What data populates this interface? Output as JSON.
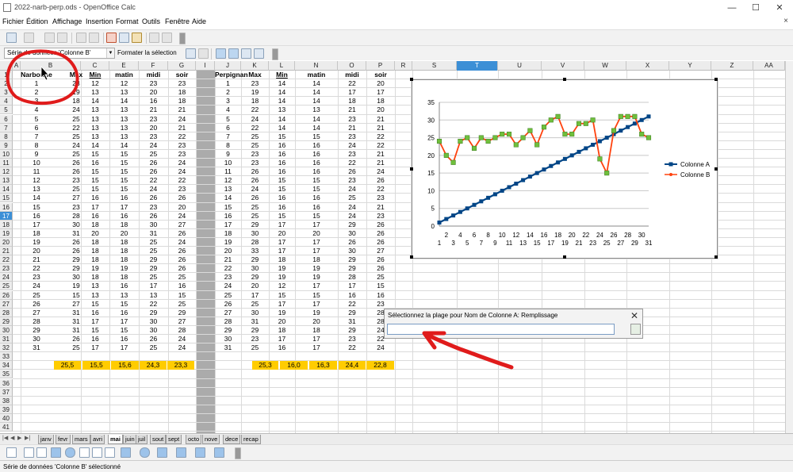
{
  "window": {
    "title": "2022-narb-perp.ods - OpenOffice Calc",
    "minimize": "—",
    "maximize": "☐",
    "close": "✕"
  },
  "menus": [
    "Fichier",
    "Édition",
    "Affichage",
    "Insertion",
    "Format",
    "Outils",
    "Fenêtre",
    "Aide"
  ],
  "menu_close": "×",
  "toolbar2": {
    "series_selector": "Série de données 'Colonne B'",
    "format_selection_label": "Formater la sélection"
  },
  "columns": [
    "A",
    "B",
    "C",
    "E",
    "F",
    "G",
    "I",
    "J",
    "K",
    "L",
    "N",
    "O",
    "P",
    "R",
    "S",
    "T",
    "U",
    "V",
    "W",
    "X",
    "Y",
    "Z",
    "AA"
  ],
  "selected_column": "T",
  "table_left": {
    "headers": [
      "Narbonne",
      "Max",
      "Min",
      "matin",
      "midi",
      "soir"
    ],
    "rows": [
      [
        1,
        23,
        12,
        12,
        23,
        23
      ],
      [
        2,
        19,
        13,
        13,
        20,
        18
      ],
      [
        3,
        18,
        14,
        14,
        16,
        18
      ],
      [
        4,
        24,
        13,
        13,
        21,
        21
      ],
      [
        5,
        25,
        13,
        13,
        23,
        24
      ],
      [
        6,
        22,
        13,
        13,
        20,
        21
      ],
      [
        7,
        25,
        13,
        13,
        23,
        22
      ],
      [
        8,
        24,
        14,
        14,
        24,
        23
      ],
      [
        9,
        25,
        15,
        15,
        25,
        23
      ],
      [
        10,
        26,
        16,
        15,
        26,
        24
      ],
      [
        11,
        26,
        15,
        15,
        26,
        24
      ],
      [
        12,
        23,
        15,
        15,
        22,
        22
      ],
      [
        13,
        25,
        15,
        15,
        24,
        23
      ],
      [
        14,
        27,
        16,
        16,
        26,
        26
      ],
      [
        15,
        23,
        17,
        17,
        23,
        20
      ],
      [
        16,
        28,
        16,
        16,
        26,
        24
      ],
      [
        17,
        30,
        18,
        18,
        30,
        27
      ],
      [
        18,
        31,
        20,
        20,
        31,
        26
      ],
      [
        19,
        26,
        18,
        18,
        25,
        24
      ],
      [
        20,
        26,
        18,
        18,
        25,
        26
      ],
      [
        21,
        29,
        18,
        18,
        29,
        26
      ],
      [
        22,
        29,
        19,
        19,
        29,
        26
      ],
      [
        23,
        30,
        18,
        18,
        25,
        25
      ],
      [
        24,
        19,
        13,
        16,
        17,
        16
      ],
      [
        25,
        15,
        13,
        13,
        13,
        15
      ],
      [
        26,
        27,
        15,
        15,
        22,
        25
      ],
      [
        27,
        31,
        16,
        16,
        29,
        29
      ],
      [
        28,
        31,
        17,
        17,
        30,
        27
      ],
      [
        29,
        31,
        15,
        15,
        30,
        28
      ],
      [
        30,
        26,
        16,
        16,
        26,
        24
      ],
      [
        31,
        25,
        17,
        17,
        25,
        24
      ]
    ],
    "averages": [
      "25,5",
      "15,5",
      "15,6",
      "24,3",
      "23,3"
    ]
  },
  "table_right": {
    "headers": [
      "Perpignan",
      "Max",
      "Min",
      "matin",
      "midi",
      "soir"
    ],
    "rows": [
      [
        1,
        23,
        14,
        14,
        22,
        20
      ],
      [
        2,
        19,
        14,
        14,
        17,
        17
      ],
      [
        3,
        18,
        14,
        14,
        18,
        18
      ],
      [
        4,
        22,
        13,
        13,
        21,
        20
      ],
      [
        5,
        24,
        14,
        14,
        23,
        21
      ],
      [
        6,
        22,
        14,
        14,
        21,
        21
      ],
      [
        7,
        25,
        15,
        15,
        23,
        22
      ],
      [
        8,
        25,
        16,
        16,
        24,
        22
      ],
      [
        9,
        23,
        16,
        16,
        23,
        21
      ],
      [
        10,
        23,
        16,
        16,
        22,
        21
      ],
      [
        11,
        26,
        16,
        16,
        26,
        24
      ],
      [
        12,
        26,
        15,
        15,
        23,
        26
      ],
      [
        13,
        24,
        15,
        15,
        24,
        22
      ],
      [
        14,
        26,
        16,
        16,
        25,
        23
      ],
      [
        15,
        25,
        16,
        16,
        24,
        21
      ],
      [
        16,
        25,
        15,
        15,
        24,
        23
      ],
      [
        17,
        29,
        17,
        17,
        29,
        26
      ],
      [
        18,
        30,
        20,
        20,
        30,
        26
      ],
      [
        19,
        28,
        17,
        17,
        26,
        26
      ],
      [
        20,
        33,
        17,
        17,
        30,
        27
      ],
      [
        21,
        29,
        18,
        18,
        29,
        26
      ],
      [
        22,
        30,
        19,
        19,
        29,
        26
      ],
      [
        23,
        29,
        19,
        19,
        28,
        25
      ],
      [
        24,
        20,
        12,
        17,
        17,
        15
      ],
      [
        25,
        17,
        15,
        15,
        16,
        16
      ],
      [
        26,
        25,
        17,
        17,
        22,
        23
      ],
      [
        27,
        30,
        19,
        19,
        29,
        28
      ],
      [
        28,
        31,
        20,
        20,
        31,
        28
      ],
      [
        29,
        29,
        18,
        18,
        29,
        24
      ],
      [
        30,
        23,
        17,
        17,
        23,
        22
      ],
      [
        31,
        25,
        16,
        17,
        22,
        24
      ]
    ],
    "averages": [
      "25,3",
      "16,0",
      "16,3",
      "24,4",
      "22,8"
    ]
  },
  "chart_data": {
    "type": "line",
    "x": [
      1,
      2,
      3,
      4,
      5,
      6,
      7,
      8,
      9,
      10,
      11,
      12,
      13,
      14,
      15,
      16,
      17,
      18,
      19,
      20,
      21,
      22,
      23,
      24,
      25,
      26,
      27,
      28,
      29,
      30,
      31
    ],
    "x_ticks_row1": [
      "2",
      "4",
      "6",
      "8",
      "10",
      "12",
      "14",
      "16",
      "18",
      "20",
      "22",
      "24",
      "26",
      "28",
      "30"
    ],
    "x_ticks_row2": [
      "1",
      "3",
      "5",
      "7",
      "9",
      "11",
      "13",
      "15",
      "17",
      "19",
      "21",
      "23",
      "25",
      "27",
      "29",
      "31"
    ],
    "ylim": [
      0,
      35
    ],
    "yticks": [
      "0",
      "5",
      "10",
      "15",
      "20",
      "25",
      "30",
      "35"
    ],
    "grid": true,
    "legend": "right",
    "series": [
      {
        "name": "Colonne A",
        "color": "#004586",
        "values": [
          1,
          2,
          3,
          4,
          5,
          6,
          7,
          8,
          9,
          10,
          11,
          12,
          13,
          14,
          15,
          16,
          17,
          18,
          19,
          20,
          21,
          22,
          23,
          24,
          25,
          26,
          27,
          28,
          29,
          30,
          31
        ]
      },
      {
        "name": "Colonne B",
        "color": "#ff420e",
        "values": [
          24,
          20,
          18,
          24,
          25,
          22,
          25,
          24,
          25,
          26,
          26,
          23,
          25,
          27,
          23,
          28,
          30,
          31,
          26,
          26,
          29,
          29,
          30,
          19,
          15,
          27,
          31,
          31,
          31,
          26,
          25
        ]
      }
    ]
  },
  "dialog": {
    "title": "Sélectionnez la plage pour Nom de Colonne A: Remplissage",
    "input_value": "",
    "close": "✕"
  },
  "sheet_tabs": [
    "janv",
    "fevr",
    "mars",
    "avri",
    "mai",
    "juin",
    "juil",
    "sout",
    "sept",
    "octo",
    "nove",
    "dece",
    "recap"
  ],
  "active_tab": "mai",
  "status": "Série de données 'Colonne B' sélectionné"
}
